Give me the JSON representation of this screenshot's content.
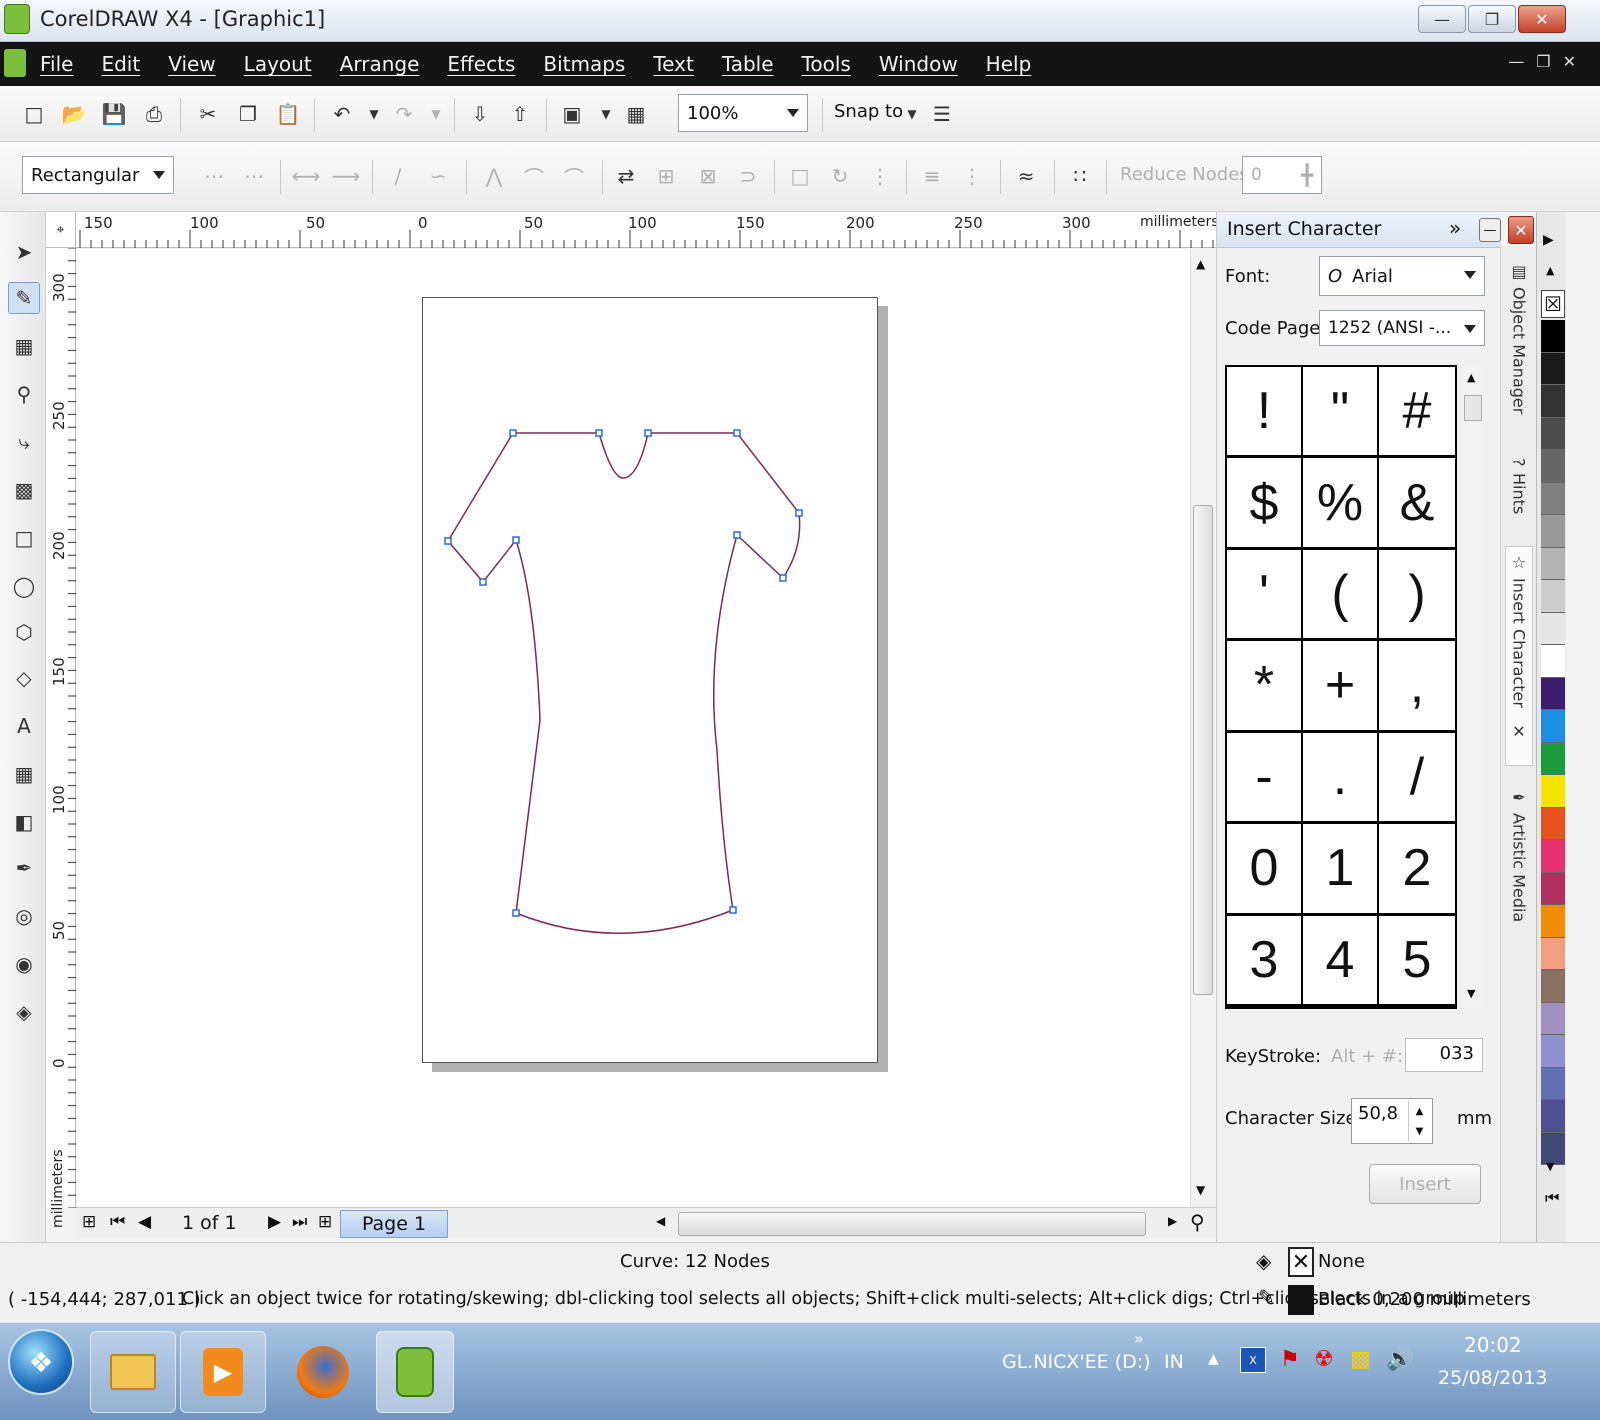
{
  "window": {
    "title": "CorelDRAW X4 - [Graphic1]"
  },
  "menu": [
    "File",
    "Edit",
    "View",
    "Layout",
    "Arrange",
    "Effects",
    "Bitmaps",
    "Text",
    "Table",
    "Tools",
    "Window",
    "Help"
  ],
  "standard_toolbar": {
    "zoom": "100%",
    "snap_to": "Snap to"
  },
  "property_bar": {
    "selection_mode": "Rectangular",
    "reduce_nodes_label": "Reduce Nodes",
    "reduce_nodes_value": "0"
  },
  "rulers": {
    "horizontal_ticks": [
      "150",
      "100",
      "50",
      "0",
      "50",
      "100",
      "150",
      "200",
      "250",
      "300"
    ],
    "horizontal_unit": "millimeters",
    "vertical_ticks": [
      "300",
      "250",
      "200",
      "150",
      "100",
      "50",
      "0"
    ],
    "vertical_unit": "millimeters"
  },
  "page_nav": {
    "counter": "1 of 1",
    "tab": "Page 1"
  },
  "docker": {
    "title": "Insert Character",
    "font_label": "Font:",
    "font_value": "Arial",
    "codepage_label": "Code Page:",
    "codepage_value": "1252  (ANSI -...",
    "characters": [
      "!",
      "\"",
      "#",
      "$",
      "%",
      "&",
      "'",
      "(",
      ")",
      "*",
      "+",
      ",",
      "-",
      ".",
      "/",
      "0",
      "1",
      "2",
      "3",
      "4",
      "5"
    ],
    "keystroke_label": "KeyStroke:",
    "keystroke_prefix": "Alt +  #:",
    "keystroke_value": "033",
    "char_size_label": "Character Size:",
    "char_size_value": "50,8",
    "char_size_unit": "mm",
    "insert_button": "Insert"
  },
  "side_tabs": [
    "Object Manager",
    "Hints",
    "Insert Character",
    "Artistic Media"
  ],
  "palette": [
    "#000000",
    "#1a1a1a",
    "#333333",
    "#4d4d4d",
    "#666666",
    "#808080",
    "#999999",
    "#b3b3b3",
    "#cccccc",
    "#e6e6e6",
    "#ffffff",
    "#3a1d6e",
    "#1e8fe0",
    "#1a9b3c",
    "#f5e400",
    "#e8501e",
    "#e83070",
    "#b03060",
    "#f08c00",
    "#f0a080",
    "#8a7060",
    "#a090c0",
    "#9090d0",
    "#6070b0",
    "#505090",
    "#404878"
  ],
  "status": {
    "object_info": "Curve: 12 Nodes",
    "coords": "( -154,444; 287,011 )",
    "hint": "Click an object twice for rotating/skewing; dbl-clicking tool selects all objects; Shift+click multi-selects; Alt+click digs; Ctrl+click selects in a group",
    "fill": "None",
    "outline": "Black  0,200 millimeters"
  },
  "taskbar": {
    "drive": "GL.NICX'EE (D:)",
    "lang": "IN",
    "time": "20:02",
    "date": "25/08/2013"
  }
}
